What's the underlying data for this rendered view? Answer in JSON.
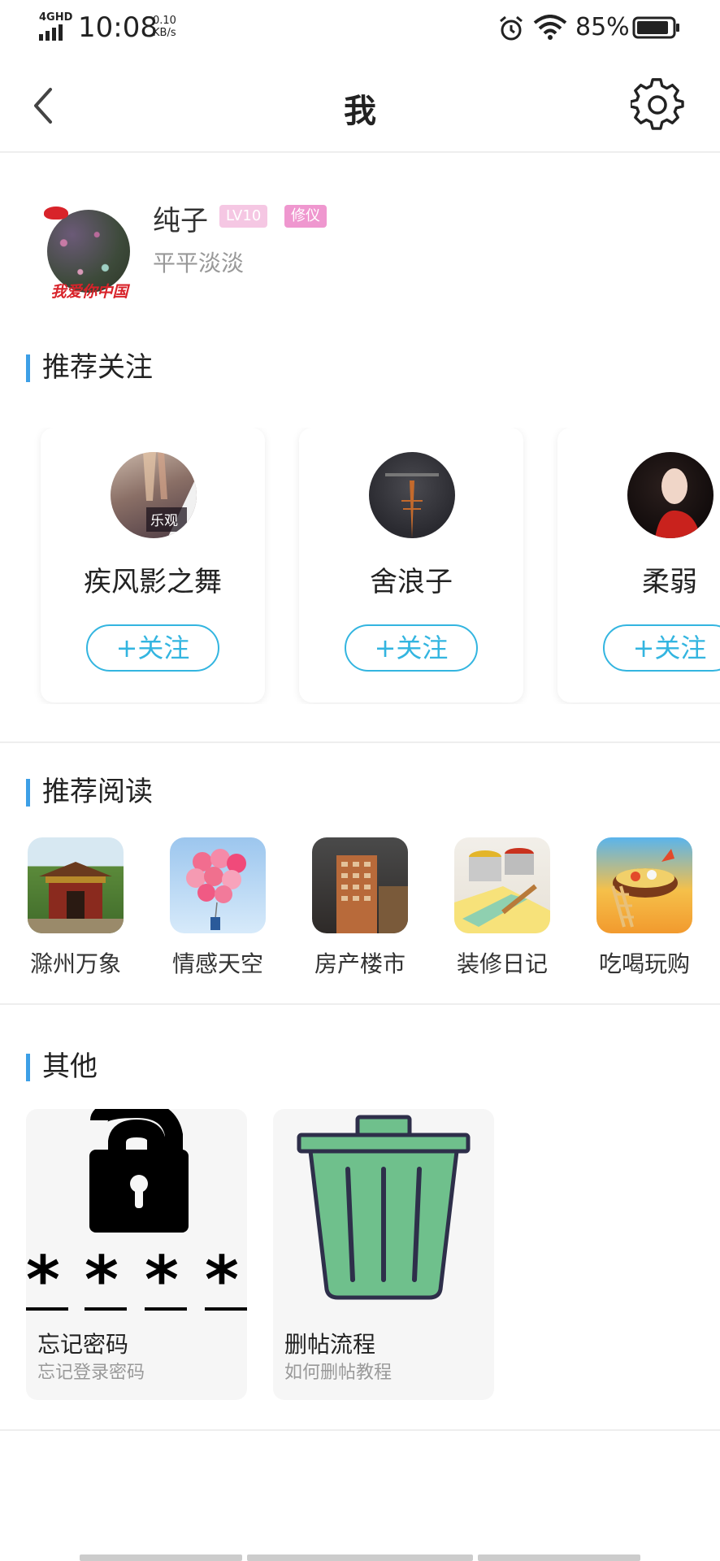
{
  "status_bar": {
    "network": "4GHD",
    "time": "10:08",
    "speed_value": "0.10",
    "speed_unit": "KB/s",
    "battery_percent": "85%"
  },
  "header": {
    "title": "我",
    "back_icon": "chevron-left-icon",
    "settings_icon": "gear-icon"
  },
  "profile": {
    "avatar_text": "我爱你中国",
    "name": "纯子",
    "level_badge": "LV10",
    "role_badge": "修仪",
    "signature": "平平淡淡"
  },
  "recommend_follow": {
    "title": "推荐关注",
    "items": [
      {
        "name": "疾风影之舞",
        "avatar_text": "乐观",
        "button": "+关注"
      },
      {
        "name": "舍浪子",
        "button": "+关注"
      },
      {
        "name": "柔弱",
        "button": "+关注"
      }
    ]
  },
  "recommend_read": {
    "title": "推荐阅读",
    "items": [
      {
        "label": "滁州万象"
      },
      {
        "label": "情感天空"
      },
      {
        "label": "房产楼市"
      },
      {
        "label": "装修日记"
      },
      {
        "label": "吃喝玩购"
      }
    ]
  },
  "other": {
    "title": "其他",
    "items": [
      {
        "title": "忘记密码",
        "subtitle": "忘记登录密码",
        "icon": "lock-password-icon"
      },
      {
        "title": "删帖流程",
        "subtitle": "如何删帖教程",
        "icon": "trash-can-icon"
      }
    ]
  },
  "colors": {
    "accent": "#3d9fe6",
    "follow": "#33b5e0",
    "badge_level": "#f5c7e3",
    "badge_role": "#ef97cf"
  }
}
